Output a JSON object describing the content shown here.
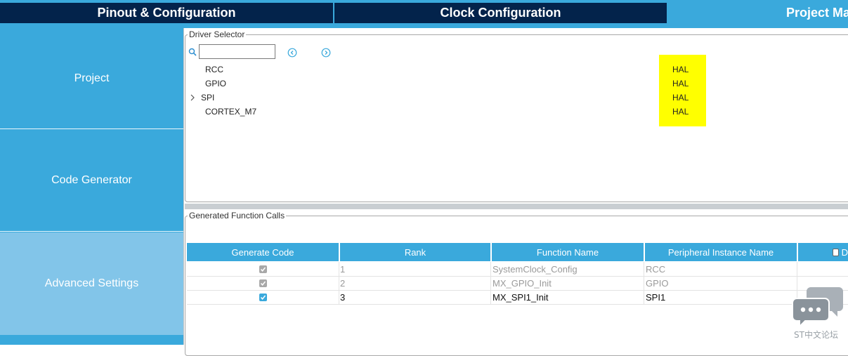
{
  "tabs": [
    {
      "label": "Pinout & Configuration"
    },
    {
      "label": "Clock Configuration"
    },
    {
      "label": "Project Ma"
    }
  ],
  "sidebar": {
    "items": [
      {
        "label": "Project"
      },
      {
        "label": "Code Generator"
      },
      {
        "label": "Advanced Settings"
      }
    ]
  },
  "driver_selector": {
    "title": "Driver Selector",
    "search_value": "",
    "drivers": [
      {
        "name": "RCC",
        "type": "HAL"
      },
      {
        "name": "GPIO",
        "type": "HAL"
      },
      {
        "name": "SPI",
        "type": "HAL"
      },
      {
        "name": "CORTEX_M7",
        "type": "HAL"
      }
    ]
  },
  "generated_calls": {
    "title": "Generated Function Calls",
    "columns": [
      "Generate Code",
      "Rank",
      "Function Name",
      "Peripheral Instance Name",
      "D"
    ],
    "rows": [
      {
        "rank": "1",
        "function": "SystemClock_Config",
        "instance": "RCC",
        "checked": true,
        "enabled": false
      },
      {
        "rank": "2",
        "function": "MX_GPIO_Init",
        "instance": "GPIO",
        "checked": true,
        "enabled": false
      },
      {
        "rank": "3",
        "function": "MX_SPI1_Init",
        "instance": "SPI1",
        "checked": true,
        "enabled": true
      }
    ]
  },
  "watermark": {
    "text": "ST中文论坛"
  },
  "colors": {
    "accent": "#3aa9dc",
    "navy": "#03234b",
    "highlight": "#ffff00",
    "sidebar_active": "#82c5e9"
  }
}
